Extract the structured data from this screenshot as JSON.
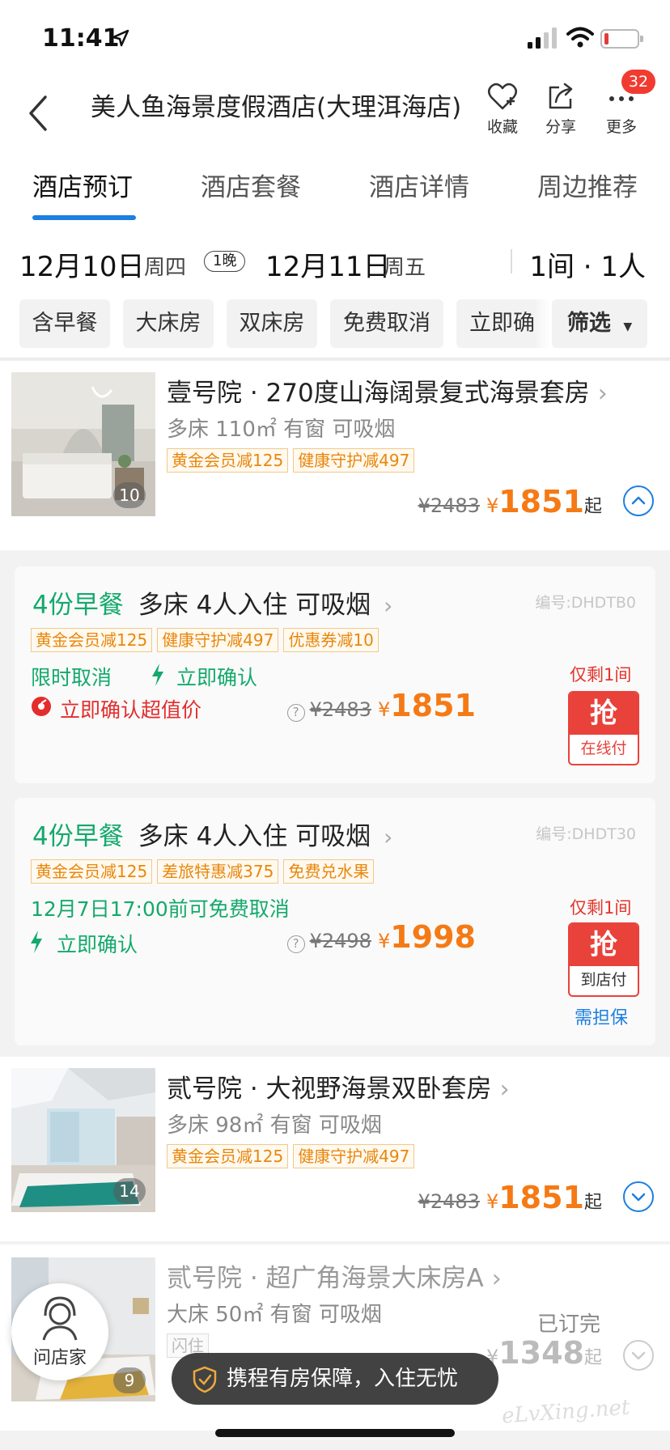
{
  "status": {
    "time": "11:41"
  },
  "header": {
    "title": "美人鱼海景度假酒店(大理洱海店)",
    "actions": [
      {
        "label": "收藏",
        "icon": "heart-plus-icon"
      },
      {
        "label": "分享",
        "icon": "share-icon"
      },
      {
        "label": "更多",
        "icon": "more-icon"
      }
    ],
    "badge": "32"
  },
  "tabs": [
    "酒店预订",
    "酒店套餐",
    "酒店详情",
    "周边推荐"
  ],
  "dates": {
    "checkin": "12月10日",
    "checkin_week": "周四",
    "nights": "1晚",
    "checkout": "12月11日",
    "checkout_week": "周五",
    "rooms_guests": "1间 · 1人"
  },
  "filters": [
    "含早餐",
    "大床房",
    "双床房",
    "免费取消",
    "立即确"
  ],
  "filter_button": "筛选",
  "rooms": [
    {
      "name": "壹号院 · 270度山海阔景复式海景套房",
      "spec": "多床 110㎡  有窗  可吸烟",
      "promos": [
        "黄金会员减125",
        "健康守护减497"
      ],
      "photo_count": "10",
      "orig": "¥2483",
      "cur_sym": "¥",
      "price": "1851",
      "suffix": "起"
    },
    {
      "name": "贰号院 · 大视野海景双卧套房",
      "spec": "多床 98㎡  有窗  可吸烟",
      "promos": [
        "黄金会员减125",
        "健康守护减497"
      ],
      "photo_count": "14",
      "orig": "¥2483",
      "cur_sym": "¥",
      "price": "1851",
      "suffix": "起"
    },
    {
      "name": "贰号院 · 超广角海景大床房A",
      "spec": "大床 50㎡  有窗  可吸烟",
      "promos": [
        "闪住"
      ],
      "photo_count": "9",
      "sold_out": "已订完",
      "cur_sym": "¥",
      "price": "1348",
      "suffix": "起"
    }
  ],
  "packages": [
    {
      "breakfast": "4份早餐",
      "detail": "多床  4人入住  可吸烟",
      "code": "编号:DHDTB0",
      "promos": [
        "黄金会员减125",
        "健康守护减497",
        "优惠券减10"
      ],
      "cancel": "限时取消",
      "confirm": "立即确认",
      "note": "立即确认超值价",
      "remain": "仅剩1间",
      "orig": "¥2483",
      "cur_sym": "¥",
      "price": "1851",
      "grab": "抢",
      "pay": "在线付"
    },
    {
      "breakfast": "4份早餐",
      "detail": "多床  4人入住  可吸烟",
      "code": "编号:DHDT30",
      "promos": [
        "黄金会员减125",
        "差旅特惠减375",
        "免费兑水果"
      ],
      "cancel": "12月7日17:00前可免费取消",
      "confirm": "立即确认",
      "remain": "仅剩1间",
      "orig": "¥2498",
      "cur_sym": "¥",
      "price": "1998",
      "grab": "抢",
      "pay": "到店付",
      "deposit": "需担保"
    }
  ],
  "ask_host": "问店家",
  "toast": "携程有房保障，入住无忧",
  "watermark": "eLvXing.net"
}
